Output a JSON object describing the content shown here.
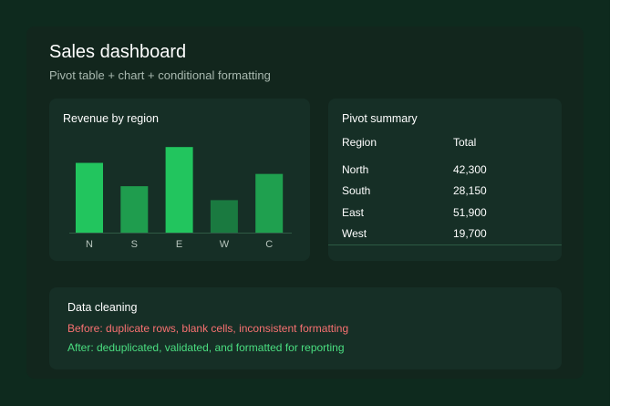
{
  "header": {
    "title": "Sales dashboard",
    "subtitle": "Pivot table + chart + conditional formatting"
  },
  "chart_panel": {
    "heading": "Revenue by region"
  },
  "chart_data": {
    "type": "bar",
    "categories": [
      "N",
      "S",
      "E",
      "W",
      "C"
    ],
    "values": [
      42300,
      28150,
      51900,
      19700,
      35600
    ],
    "bar_colors": [
      "#22c55e",
      "#1f9d4e",
      "#22c55e",
      "#1a7a40",
      "#1fa04f"
    ],
    "title": "Revenue by region",
    "xlabel": "",
    "ylabel": "",
    "ylim": [
      0,
      52000
    ],
    "grid": false,
    "legend": "none"
  },
  "pivot": {
    "heading": "Pivot summary",
    "columns": [
      "Region",
      "Total"
    ],
    "rows": [
      {
        "region": "North",
        "total": "42,300"
      },
      {
        "region": "South",
        "total": "28,150"
      },
      {
        "region": "East",
        "total": "51,900"
      },
      {
        "region": "West",
        "total": "19,700"
      }
    ]
  },
  "cleaning": {
    "heading": "Data cleaning",
    "before": "Before: duplicate rows, blank cells, inconsistent formatting",
    "after": "After: deduplicated, validated, and formatted for reporting",
    "before_color": "#f87171",
    "after_color": "#4ade80"
  },
  "colors": {
    "background": "#0e2a1e",
    "card": "#12261d",
    "panel": "#162f26",
    "accent": "#22c55e"
  }
}
